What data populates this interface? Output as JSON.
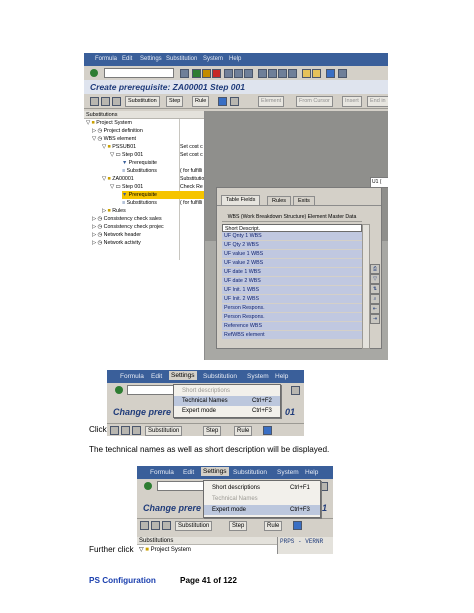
{
  "screenshot1": {
    "menu": [
      "Formula",
      "Edit",
      "Settings",
      "Substitution",
      "System",
      "Help"
    ],
    "window_title": "Create prerequisite: ZA00001 Step 001",
    "app_toolbar": [
      "Substitution",
      "Step",
      "Rule",
      "Element",
      "From Cursor",
      "Insert",
      "End in"
    ],
    "tree_header": "Substitutions",
    "tree": [
      {
        "label": "Project System",
        "desc": ""
      },
      {
        "label": "Project definition",
        "desc": ""
      },
      {
        "label": "WBS element",
        "desc": ""
      },
      {
        "label": "PSSUB01",
        "desc": "Set cost c"
      },
      {
        "label": "Step 001",
        "desc": "Set cost c"
      },
      {
        "label": "Prerequisite",
        "desc": ""
      },
      {
        "label": "Substitutions",
        "desc": "( for fulfilli"
      },
      {
        "label": "ZA00001",
        "desc": "Substitutio"
      },
      {
        "label": "Step 001",
        "desc": "Check Re"
      },
      {
        "label": "Prerequisite",
        "desc": ""
      },
      {
        "label": "Substitutions",
        "desc": "( for fulfilli"
      },
      {
        "label": "Rules",
        "desc": ""
      },
      {
        "label": "Consistency check sales",
        "desc": ""
      },
      {
        "label": "Consistency check projec",
        "desc": ""
      },
      {
        "label": "Network header",
        "desc": ""
      },
      {
        "label": "Network activity",
        "desc": ""
      }
    ],
    "right_label": "U1 (",
    "tabs": [
      "Table Fields",
      "Rules",
      "Exits"
    ],
    "dialog_title": "WBS (Work Breakdown Structure) Element Master Data",
    "field_header": "Short Descript.",
    "fields": [
      "UF Qnty 1 WBS",
      "UF Qty 2 WBS",
      "UF value 1 WBS",
      "UF value 2 WBS",
      "UF date 1 WBS",
      "UF date 2 WBS",
      "UF Init. 1 WBS",
      "UF Init. 2 WBS",
      "Person Respons.",
      "Person Respons.",
      "Reference WBS",
      "RefWBS element"
    ]
  },
  "screenshot2": {
    "menu": [
      "Formula",
      "Edit",
      "Settings",
      "Substitution",
      "System",
      "Help"
    ],
    "highlighted_menu": "Settings",
    "title": "Change prere",
    "title_tail": "01",
    "popup": [
      {
        "label": "Short descriptions",
        "shortcut": "",
        "disabled": true
      },
      {
        "label": "Technical Names",
        "shortcut": "Ctrl+F2",
        "disabled": false
      },
      {
        "label": "Expert mode",
        "shortcut": "Ctrl+F3",
        "disabled": false
      }
    ],
    "toolbar": [
      "Substitution",
      "Step",
      "Rule"
    ]
  },
  "screenshot3": {
    "menu": [
      "Formula",
      "Edit",
      "Settings",
      "Substitution",
      "System",
      "Help"
    ],
    "highlighted_menu": "Settings",
    "title": "Change prere",
    "title_tail": "01",
    "popup": [
      {
        "label": "Short descriptions",
        "shortcut": "Ctrl+F1",
        "disabled": false
      },
      {
        "label": "Technical Names",
        "shortcut": "",
        "disabled": true
      },
      {
        "label": "Expert mode",
        "shortcut": "Ctrl+F3",
        "disabled": false
      }
    ],
    "toolbar": [
      "Substitution",
      "Step",
      "Rule"
    ],
    "tree_header": "Substitutions",
    "tree_row": "Project System",
    "right_value": "PRPS - VERNR"
  },
  "doc": {
    "click_label": "Click",
    "sentence": "The technical names as well as short description will be displayed.",
    "further_click": "Further  click",
    "footer_left": "PS Configuration",
    "footer_right": "Page 41 of 122"
  }
}
